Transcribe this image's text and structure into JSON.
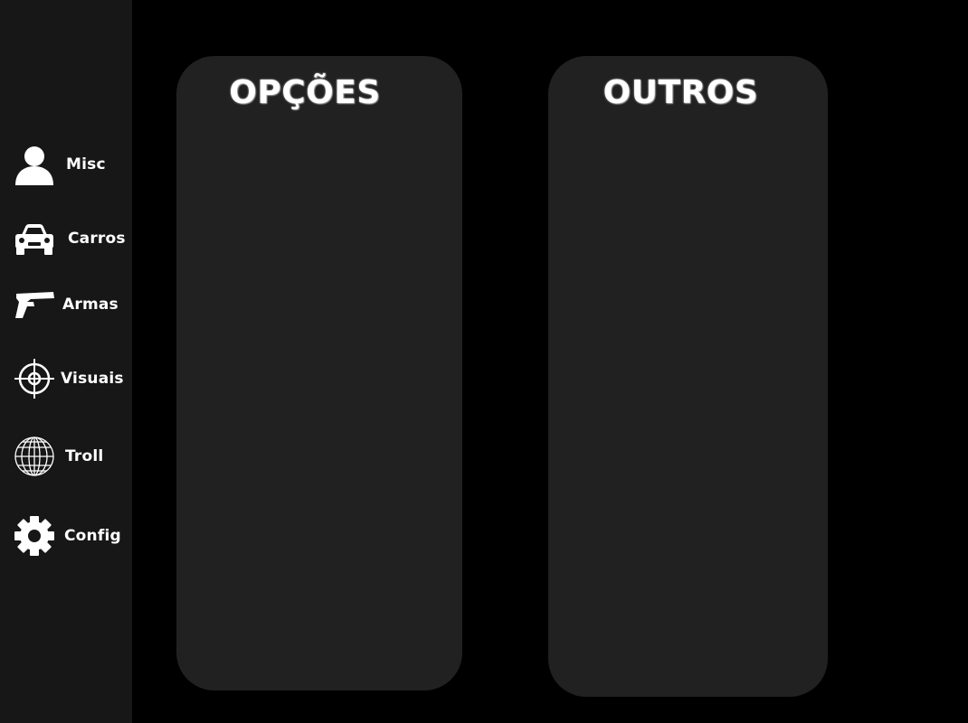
{
  "sidebar": {
    "items": [
      {
        "label": "Misc",
        "icon": "user-icon"
      },
      {
        "label": "Carros",
        "icon": "car-icon"
      },
      {
        "label": "Armas",
        "icon": "pistol-icon"
      },
      {
        "label": "Visuais",
        "icon": "crosshair-icon"
      },
      {
        "label": "Troll",
        "icon": "globe-icon"
      },
      {
        "label": "Config",
        "icon": "gear-icon"
      }
    ]
  },
  "panels": {
    "options": {
      "title": "OPÇÕES"
    },
    "others": {
      "title": "OUTROS"
    }
  },
  "colors": {
    "background": "#000000",
    "sidebar": "#171717",
    "panel": "#212121",
    "text": "#ffffff"
  }
}
